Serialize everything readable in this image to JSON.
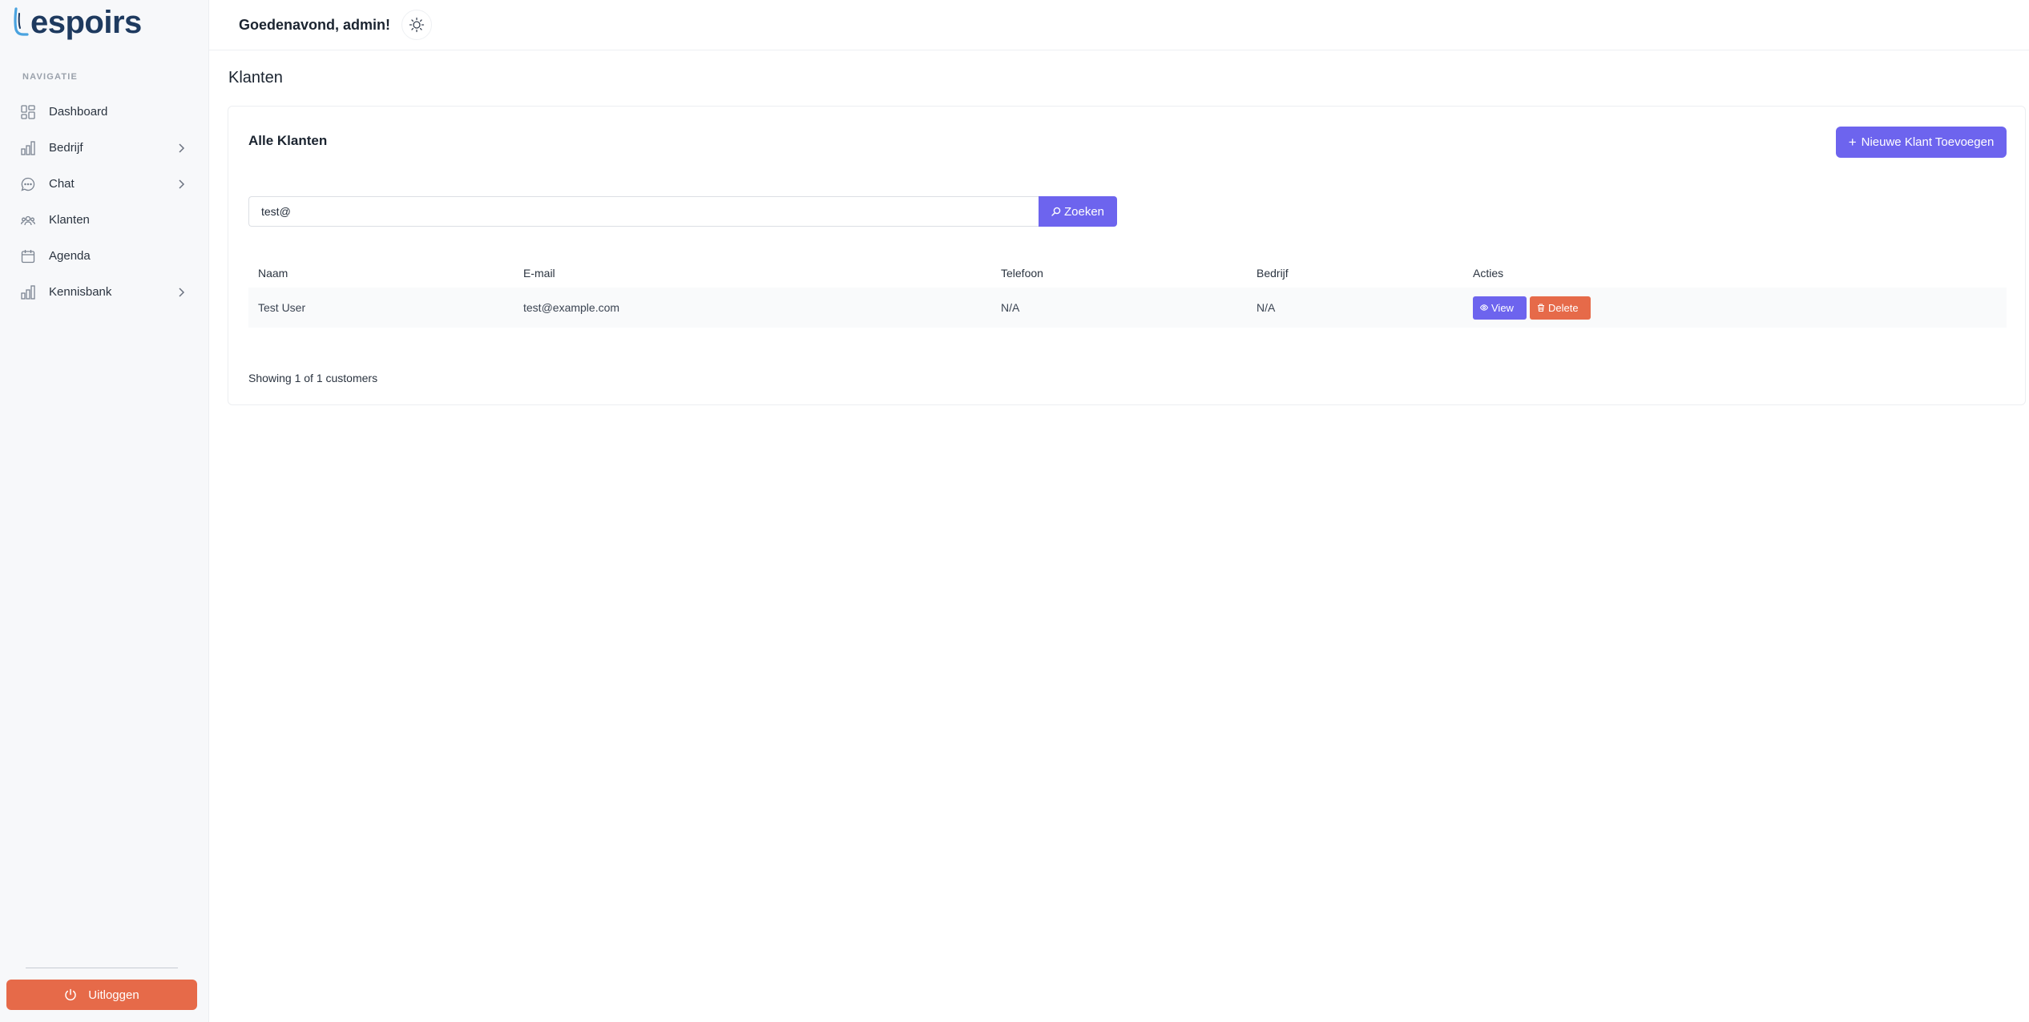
{
  "brand": {
    "logo_text": "espoirs",
    "accent": "#6d64ee",
    "danger": "#e66a49"
  },
  "header": {
    "greeting": "Goedenavond, admin!",
    "theme_icon": "sun-icon"
  },
  "sidebar": {
    "heading": "NAVIGATIE",
    "items": [
      {
        "label": "Dashboard",
        "icon": "dashboard-grid-icon",
        "has_submenu": false
      },
      {
        "label": "Bedrijf",
        "icon": "bar-chart-icon",
        "has_submenu": true
      },
      {
        "label": "Chat",
        "icon": "chat-bubble-icon",
        "has_submenu": true
      },
      {
        "label": "Klanten",
        "icon": "users-icon",
        "has_submenu": false
      },
      {
        "label": "Agenda",
        "icon": "calendar-icon",
        "has_submenu": false
      },
      {
        "label": "Kennisbank",
        "icon": "bar-chart-icon",
        "has_submenu": true
      }
    ],
    "logout_label": "Uitloggen"
  },
  "page": {
    "title": "Klanten",
    "card_title": "Alle Klanten",
    "add_button_label": "Nieuwe Klant Toevoegen",
    "search": {
      "value": "test@",
      "placeholder": "",
      "button_label": "Zoeken"
    },
    "table": {
      "headers": [
        "Naam",
        "E-mail",
        "Telefoon",
        "Bedrijf",
        "Acties"
      ],
      "rows": [
        {
          "name": "Test User",
          "email": "test@example.com",
          "phone": "N/A",
          "company": "N/A"
        }
      ],
      "view_label": "View",
      "delete_label": "Delete"
    },
    "footer_text": "Showing 1 of 1 customers"
  }
}
